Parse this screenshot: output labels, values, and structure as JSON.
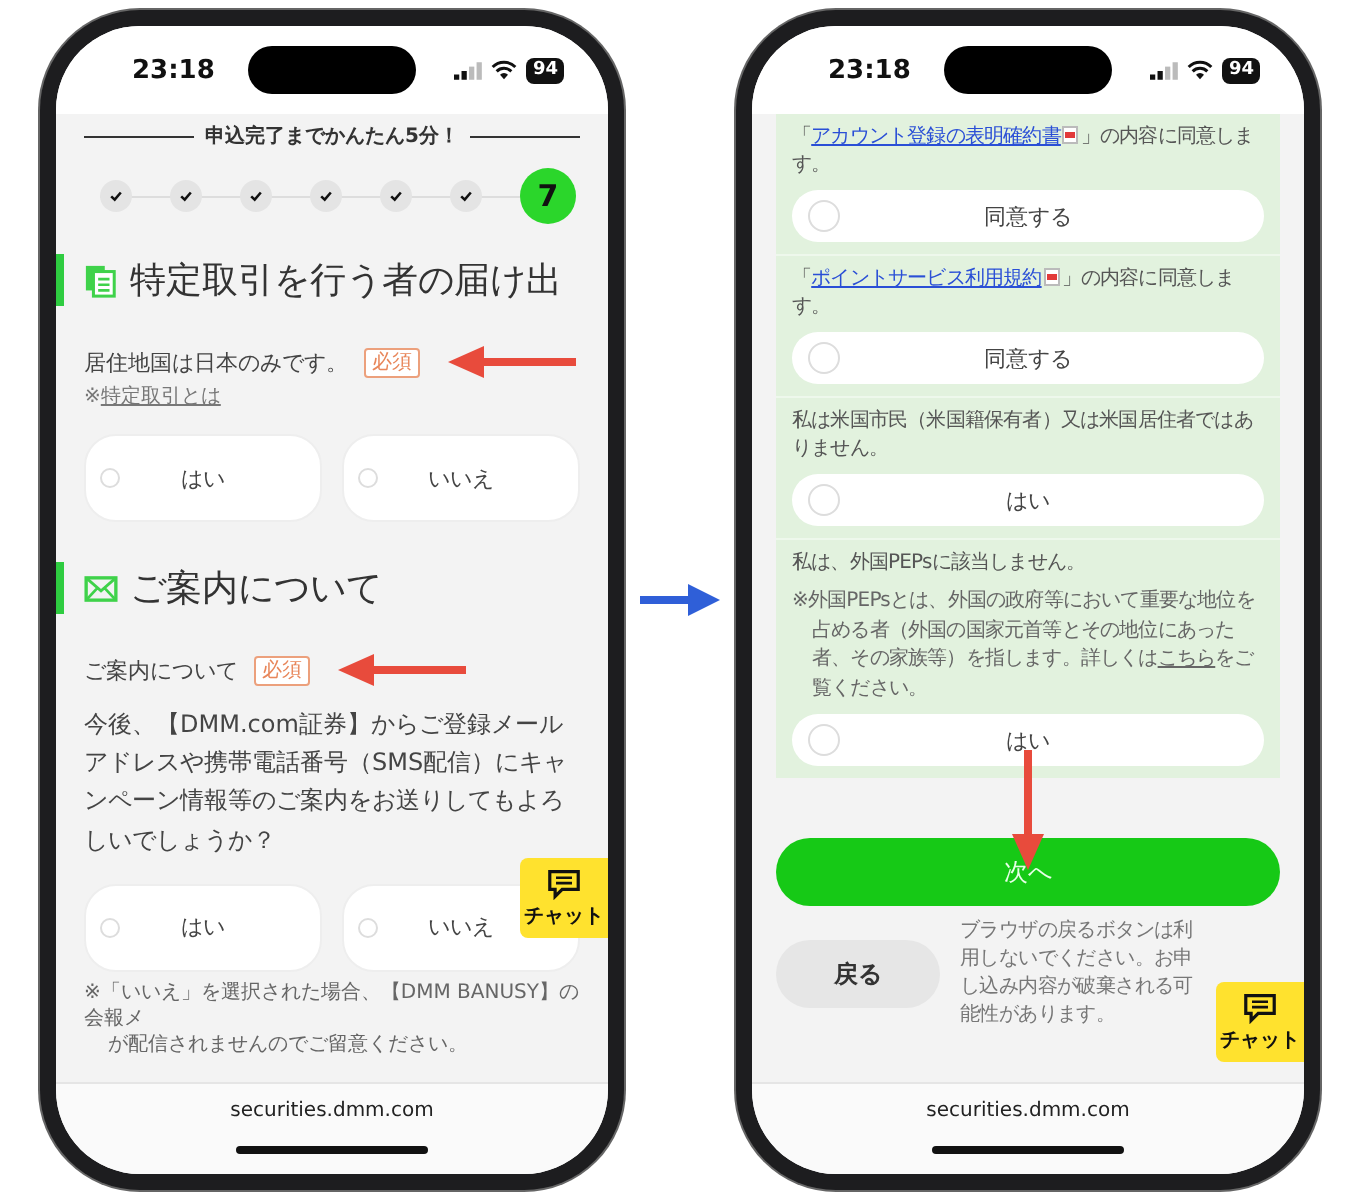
{
  "left_screen": {
    "status_bar": {
      "time": "23:18",
      "battery": "94"
    },
    "progress": {
      "title": "申込完了までかんたん5分！",
      "steps": [
        {
          "kind": "done"
        },
        {
          "kind": "done"
        },
        {
          "kind": "done"
        },
        {
          "kind": "done"
        },
        {
          "kind": "done"
        },
        {
          "kind": "done"
        },
        {
          "kind": "current",
          "label": "7"
        }
      ]
    },
    "sections": [
      {
        "title": "特定取引を行う者の届け出",
        "question": {
          "label": "居住地国は日本のみです。",
          "badge": "必須",
          "note_prefix": "※",
          "note_link": "特定取引とは",
          "options": [
            {
              "label": "はい",
              "selected": false
            },
            {
              "label": "いいえ",
              "selected": false
            }
          ]
        }
      },
      {
        "title": "ご案内について",
        "question": {
          "label": "ご案内について",
          "badge": "必須",
          "body": "今後、【DMM.com証券】からご登録メールアドレスや携帯電話番号（SMS配信）にキャンペーン情報等のご案内をお送りしてもよろしいでしょうか？",
          "options": [
            {
              "label": "はい",
              "selected": false
            },
            {
              "label": "いいえ",
              "selected": false
            }
          ],
          "footnote": [
            "※「いいえ」を選択された場合、【DMM BANUSY】の会報メ",
            "が配信されませんのでご留意ください。"
          ]
        }
      }
    ],
    "chat": "チャット",
    "url": "securities.dmm.com"
  },
  "right_screen": {
    "status_bar": {
      "time": "23:18",
      "battery": "94"
    },
    "items": [
      {
        "kind": "link",
        "prefix": "「",
        "link": "アカウント登録の表明確約書",
        "suffix": "」の内容に同意します。",
        "option": {
          "label": "同意する",
          "selected": false
        }
      },
      {
        "kind": "link",
        "prefix": "「",
        "link": "ポイントサービス利用規約",
        "suffix": "」の内容に同意します。",
        "option": {
          "label": "同意する",
          "selected": false
        }
      },
      {
        "kind": "plain",
        "text": "私は米国市民（米国籍保有者）又は米国居住者ではありません。",
        "option": {
          "label": "はい",
          "selected": false
        }
      },
      {
        "kind": "note",
        "text": "私は、外国PEPsに該当しません。",
        "note_before": "※外国PEPsとは、外国の政府等において重要な地位を占める者（外国の国家元首等とその地位にあった者、その家族等）を指します。詳しくは",
        "note_link": "こちら",
        "note_after": "をご覧ください。",
        "option": {
          "label": "はい",
          "selected": false
        }
      }
    ],
    "next_button": "次へ",
    "back_button": "戻る",
    "notice": "ブラウザの戻るボタンは利用しないでください。お申し込み内容が破棄される可能性があります。",
    "chat": "チャット",
    "url": "securities.dmm.com"
  }
}
